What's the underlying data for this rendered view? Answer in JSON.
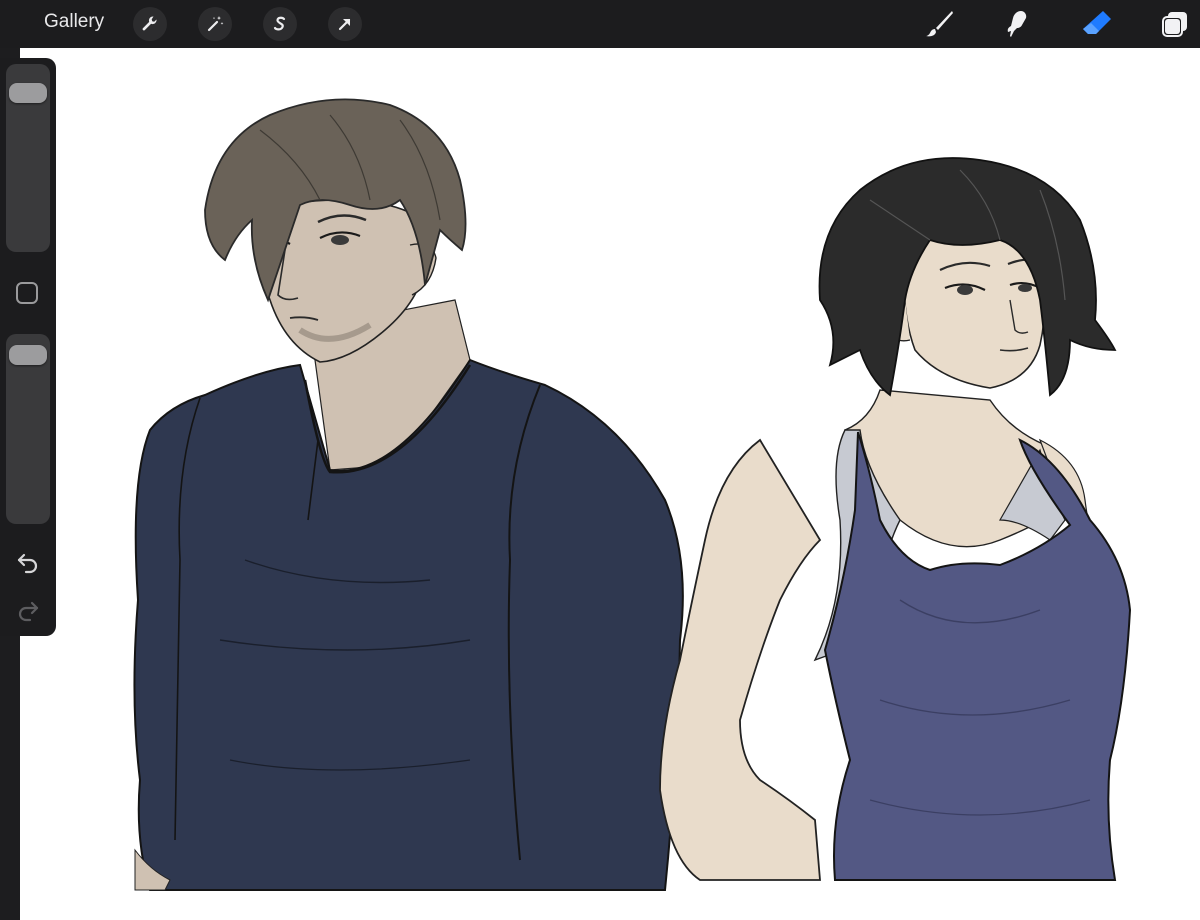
{
  "toolbar": {
    "gallery_label": "Gallery",
    "left_tools": [
      "wrench-icon",
      "magic-wand-icon",
      "selection-s-icon",
      "transform-arrow-icon"
    ],
    "right_tools": [
      "brush-icon",
      "smudge-icon",
      "eraser-icon",
      "layers-icon"
    ],
    "active_tool": "eraser-icon",
    "active_color": "#1f7bff"
  },
  "sidebar": {
    "brush_size_level": 0.1,
    "opacity_level": 0.05,
    "icons": [
      "modify-square-icon",
      "undo-icon",
      "redo-icon"
    ]
  },
  "canvas": {
    "background": "#ffffff",
    "figures": [
      "man-in-navy-henley",
      "woman-in-purple-tank-top"
    ],
    "colors": {
      "navy_shirt": "#2f3850",
      "purple_tank": "#535884",
      "skin_man": "#cfc1b2",
      "skin_woman": "#e9dccb",
      "hair_man": "#6a6258",
      "hair_woman": "#2b2b2b"
    }
  }
}
